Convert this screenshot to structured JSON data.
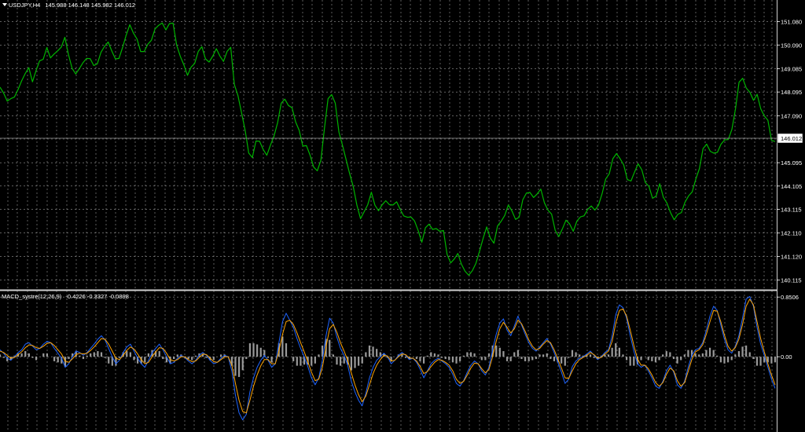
{
  "price_header": {
    "symbol": "USDJPY,H4",
    "ohlc": "145.988 146.148 145.982 146.012"
  },
  "macd_header": {
    "name": "MACD_systre",
    "params": "(12,26,9)",
    "values": "-0.4226 -0.3327 -0.0898"
  },
  "colors": {
    "background": "#000000",
    "grid": "#9a9a9a",
    "price_line": "#00b400",
    "macd_line": "#1e64ff",
    "signal_line": "#ffa500",
    "histogram": "#9a9a9a",
    "axis_text": "#ffffff"
  },
  "chart_data": [
    {
      "type": "line",
      "title": "USDJPY,H4",
      "y_ticks": [
        "151.080",
        "150.090",
        "149.085",
        "148.095",
        "147.090",
        "146.100",
        "145.095",
        "144.105",
        "143.115",
        "142.110",
        "141.120",
        "140.115"
      ],
      "ylim": [
        139.8,
        151.6
      ],
      "current_price": "146.012",
      "grid": true,
      "series": [
        {
          "values": [
            148.3,
            148.1,
            147.8,
            147.7,
            148.0,
            148.3,
            148.5,
            148.9,
            149.1,
            148.6,
            148.9,
            149.3,
            149.6,
            149.9,
            149.5,
            149.7,
            149.9,
            150.1,
            150.3,
            149.8,
            149.2,
            148.8,
            149.1,
            149.3,
            149.6,
            149.4,
            149.1,
            149.4,
            149.7,
            150.0,
            150.2,
            149.9,
            149.6,
            149.4,
            150.1,
            150.6,
            150.9,
            150.6,
            150.3,
            149.9,
            149.7,
            150.0,
            150.4,
            150.7,
            150.9,
            151.0,
            150.8,
            151.1,
            150.9,
            150.2,
            149.7,
            149.2,
            148.8,
            149.1,
            149.4,
            149.7,
            149.9,
            149.6,
            149.3,
            149.6,
            149.9,
            149.7,
            149.5,
            149.7,
            150.1,
            148.5,
            147.9,
            147.2,
            146.4,
            145.6,
            145.2,
            145.9,
            146.1,
            145.6,
            145.4,
            145.8,
            146.3,
            146.9,
            147.5,
            147.9,
            147.6,
            147.4,
            146.8,
            146.4,
            145.9,
            145.7,
            145.3,
            145.0,
            144.7,
            145.2,
            146.5,
            147.9,
            148.1,
            147.5,
            146.5,
            145.9,
            145.2,
            144.6,
            144.0,
            143.4,
            142.6,
            142.9,
            143.4,
            143.8,
            143.3,
            143.0,
            143.4,
            143.6,
            143.2,
            143.4,
            143.5,
            143.1,
            142.8,
            142.7,
            142.9,
            142.5,
            142.1,
            141.8,
            142.3,
            142.5,
            142.2,
            142.4,
            142.3,
            142.1,
            141.3,
            140.9,
            141.0,
            141.2,
            140.7,
            140.6,
            140.2,
            140.4,
            140.9,
            141.3,
            141.9,
            142.3,
            142.0,
            141.8,
            142.3,
            142.7,
            142.9,
            143.3,
            143.0,
            142.6,
            142.9,
            143.4,
            143.7,
            143.9,
            143.6,
            143.8,
            143.9,
            143.5,
            143.2,
            142.8,
            142.3,
            142.0,
            142.3,
            142.6,
            142.4,
            142.3,
            142.5,
            142.7,
            142.9,
            143.1,
            143.3,
            143.0,
            143.4,
            143.9,
            144.3,
            144.7,
            145.3,
            145.5,
            145.2,
            144.9,
            144.5,
            144.2,
            144.6,
            145.1,
            144.8,
            144.3,
            144.0,
            143.7,
            143.8,
            144.1,
            143.7,
            143.4,
            143.0,
            142.6,
            142.8,
            143.1,
            143.3,
            143.6,
            143.9,
            144.4,
            144.9,
            145.6,
            146.0,
            145.7,
            145.4,
            145.6,
            145.9,
            146.1,
            146.0,
            146.4,
            147.5,
            148.4,
            148.6,
            148.3,
            148.1,
            147.8,
            147.9,
            147.5,
            147.2,
            146.8,
            146.1,
            146.0
          ],
          "color": "#00b400"
        }
      ]
    },
    {
      "type": "line",
      "title": "MACD_systre(12,26,9)",
      "y_ticks": [
        "0.8506",
        "0.00"
      ],
      "ylim": [
        -1.05,
        0.92
      ],
      "grid": true,
      "series": [
        {
          "values": [
            0.1,
            0.05,
            -0.02,
            -0.05,
            0.0,
            0.06,
            0.1,
            0.18,
            0.2,
            0.15,
            0.1,
            0.12,
            0.18,
            0.22,
            0.2,
            0.12,
            0.05,
            -0.02,
            -0.15,
            -0.1,
            0.0,
            0.08,
            0.06,
            0.02,
            0.06,
            0.12,
            0.18,
            0.25,
            0.3,
            0.24,
            0.12,
            0.0,
            -0.1,
            -0.05,
            0.06,
            0.14,
            0.18,
            0.08,
            -0.02,
            -0.1,
            -0.15,
            -0.05,
            0.06,
            0.12,
            0.18,
            0.1,
            0.0,
            -0.1,
            -0.08,
            -0.02,
            0.02,
            -0.01,
            -0.06,
            -0.1,
            -0.05,
            0.02,
            0.06,
            0.02,
            -0.05,
            -0.1,
            -0.08,
            -0.02,
            0.02,
            0.0,
            -0.2,
            -0.55,
            -0.8,
            -0.9,
            -0.82,
            -0.5,
            -0.3,
            -0.15,
            -0.05,
            0.02,
            -0.05,
            -0.15,
            -0.1,
            0.2,
            0.5,
            0.62,
            0.52,
            0.42,
            0.26,
            0.12,
            0.0,
            -0.14,
            -0.3,
            -0.4,
            -0.3,
            -0.05,
            0.3,
            0.55,
            0.48,
            0.28,
            0.12,
            0.02,
            -0.12,
            -0.35,
            -0.5,
            -0.62,
            -0.7,
            -0.52,
            -0.3,
            -0.15,
            -0.05,
            0.0,
            0.05,
            0.0,
            -0.1,
            -0.05,
            0.02,
            0.06,
            0.02,
            -0.04,
            -0.02,
            -0.08,
            -0.18,
            -0.3,
            -0.2,
            -0.1,
            -0.05,
            -0.02,
            -0.06,
            -0.1,
            -0.15,
            -0.25,
            -0.38,
            -0.42,
            -0.34,
            -0.22,
            -0.12,
            -0.06,
            -0.1,
            -0.2,
            -0.26,
            -0.15,
            0.1,
            0.32,
            0.48,
            0.54,
            0.38,
            0.3,
            0.44,
            0.58,
            0.45,
            0.32,
            0.2,
            0.12,
            0.08,
            0.14,
            0.2,
            0.26,
            0.18,
            0.06,
            -0.08,
            -0.22,
            -0.38,
            -0.32,
            -0.14,
            -0.06,
            -0.02,
            0.0,
            0.04,
            0.08,
            0.02,
            -0.04,
            0.0,
            0.06,
            0.1,
            0.3,
            0.6,
            0.74,
            0.7,
            0.55,
            0.3,
            0.08,
            -0.1,
            -0.15,
            -0.12,
            -0.2,
            -0.3,
            -0.42,
            -0.45,
            -0.35,
            -0.2,
            -0.12,
            -0.22,
            -0.4,
            -0.45,
            -0.35,
            -0.15,
            0.02,
            0.1,
            0.12,
            0.2,
            0.38,
            0.58,
            0.72,
            0.66,
            0.45,
            0.25,
            0.1,
            0.05,
            0.15,
            0.3,
            0.55,
            0.82,
            0.86,
            0.72,
            0.42,
            0.18,
            0.02,
            -0.15,
            -0.32,
            -0.45
          ],
          "color": "#1e64ff"
        },
        {
          "values": [
            0.08,
            0.06,
            0.02,
            -0.02,
            -0.01,
            0.03,
            0.07,
            0.13,
            0.17,
            0.16,
            0.13,
            0.12,
            0.15,
            0.19,
            0.2,
            0.16,
            0.1,
            0.04,
            -0.06,
            -0.08,
            -0.03,
            0.03,
            0.05,
            0.04,
            0.05,
            0.09,
            0.14,
            0.2,
            0.26,
            0.25,
            0.18,
            0.08,
            -0.02,
            -0.04,
            0.02,
            0.09,
            0.14,
            0.11,
            0.04,
            -0.04,
            -0.1,
            -0.08,
            0.0,
            0.07,
            0.13,
            0.12,
            0.05,
            -0.04,
            -0.06,
            -0.04,
            0.0,
            0.0,
            -0.04,
            -0.07,
            -0.06,
            -0.01,
            0.04,
            0.03,
            -0.02,
            -0.07,
            -0.08,
            -0.04,
            0.0,
            0.0,
            -0.12,
            -0.38,
            -0.62,
            -0.78,
            -0.8,
            -0.62,
            -0.42,
            -0.26,
            -0.13,
            -0.04,
            -0.04,
            -0.1,
            -0.1,
            0.08,
            0.32,
            0.5,
            0.52,
            0.46,
            0.34,
            0.2,
            0.07,
            -0.07,
            -0.22,
            -0.34,
            -0.32,
            -0.15,
            0.14,
            0.4,
            0.46,
            0.35,
            0.2,
            0.08,
            -0.05,
            -0.23,
            -0.4,
            -0.54,
            -0.64,
            -0.56,
            -0.4,
            -0.24,
            -0.12,
            -0.04,
            0.02,
            0.01,
            -0.06,
            -0.05,
            0.0,
            0.04,
            0.03,
            -0.02,
            -0.02,
            -0.06,
            -0.14,
            -0.24,
            -0.21,
            -0.14,
            -0.08,
            -0.04,
            -0.05,
            -0.08,
            -0.12,
            -0.2,
            -0.32,
            -0.38,
            -0.35,
            -0.26,
            -0.16,
            -0.09,
            -0.1,
            -0.17,
            -0.23,
            -0.18,
            0.0,
            0.22,
            0.4,
            0.49,
            0.42,
            0.34,
            0.4,
            0.52,
            0.47,
            0.36,
            0.24,
            0.15,
            0.1,
            0.12,
            0.18,
            0.23,
            0.2,
            0.1,
            -0.03,
            -0.16,
            -0.3,
            -0.31,
            -0.2,
            -0.1,
            -0.04,
            -0.01,
            0.02,
            0.06,
            0.03,
            -0.02,
            -0.01,
            0.04,
            0.08,
            0.22,
            0.48,
            0.66,
            0.68,
            0.58,
            0.38,
            0.16,
            -0.03,
            -0.12,
            -0.12,
            -0.17,
            -0.26,
            -0.37,
            -0.42,
            -0.37,
            -0.25,
            -0.16,
            -0.2,
            -0.34,
            -0.42,
            -0.37,
            -0.21,
            -0.04,
            0.07,
            0.1,
            0.17,
            0.32,
            0.5,
            0.66,
            0.65,
            0.5,
            0.31,
            0.15,
            0.08,
            0.13,
            0.25,
            0.46,
            0.72,
            0.82,
            0.74,
            0.5,
            0.26,
            0.07,
            -0.1,
            -0.26,
            -0.4
          ],
          "color": "#ffa500"
        }
      ]
    }
  ]
}
